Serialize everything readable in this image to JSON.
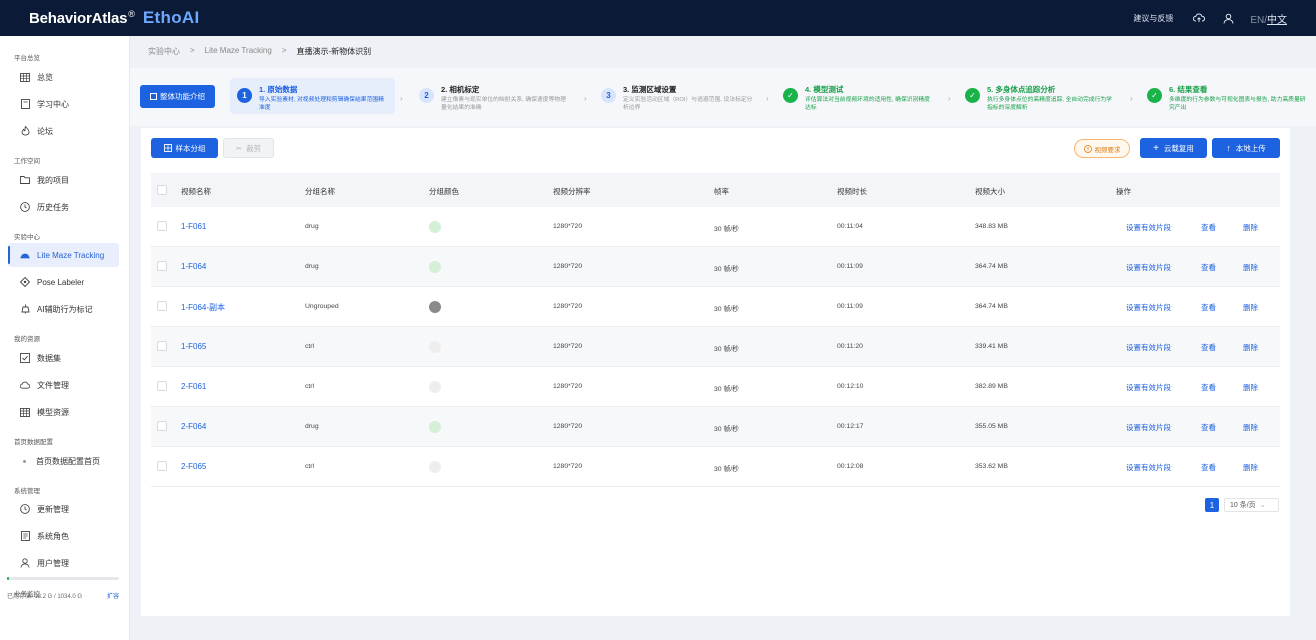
{
  "topbar": {
    "brand": "BehaviorAtlas",
    "brand_reg": "®",
    "brand_sub": "EthoAI",
    "feedback": "建议与反馈",
    "lang_en": "EN/",
    "lang_zh": "中文",
    "icons": [
      "cloud-upload-icon",
      "user-icon"
    ]
  },
  "sidebar": {
    "sections": [
      "平台总览",
      "工作空间",
      "实验中心",
      "我的资源",
      "首页数据配置",
      "系统管理",
      "业务监控"
    ],
    "items": [
      {
        "label": "总览",
        "icon": "grid-icon"
      },
      {
        "label": "学习中心",
        "icon": "book-icon"
      },
      {
        "label": "论坛",
        "icon": "fire-icon"
      },
      {
        "label": "我的项目",
        "icon": "folder-icon"
      },
      {
        "label": "历史任务",
        "icon": "clock-icon"
      },
      {
        "label": "Lite Maze Tracking",
        "icon": "maze-icon"
      },
      {
        "label": "Pose Labeler",
        "icon": "pose-icon"
      },
      {
        "label": "AI辅助行为标记",
        "icon": "ai-icon"
      },
      {
        "label": "数据集",
        "icon": "dataset-icon"
      },
      {
        "label": "文件管理",
        "icon": "cloud-icon"
      },
      {
        "label": "模型资源",
        "icon": "table-icon"
      },
      {
        "label": "首页数据配置首页",
        "icon": "dot-icon"
      },
      {
        "label": "更新管理",
        "icon": "refresh-icon"
      },
      {
        "label": "系统角色",
        "icon": "role-icon"
      },
      {
        "label": "用户管理",
        "icon": "user-icon"
      }
    ],
    "storage_text": "已用存储: 18.2 G / 1034.0 G",
    "storage_link": "扩容",
    "storage_fraction": 0.018
  },
  "breadcrumb": [
    "实验中心",
    ">",
    "Lite Maze Tracking",
    ">",
    "直播演示-新物体识别"
  ],
  "intro_button": "整体功能介绍",
  "steps": [
    {
      "num": "1",
      "title": "1. 原始数据",
      "desc": "导入实验素材, 对视频处理和剪辑确保结果范围精准度"
    },
    {
      "num": "2",
      "title": "2. 相机标定",
      "desc": "建立像素与现实单位的映射关系, 确保速度等物理量化结果的准确"
    },
    {
      "num": "3",
      "title": "3. 监测区域设置",
      "desc": "定义实验活动区域（ROI）与逃避范围, 设法标定分析边界"
    },
    {
      "num": "✓",
      "title": "4. 模型测试",
      "desc": "评估算法对当前视频环境的适用性, 确保识别精度达标"
    },
    {
      "num": "✓",
      "title": "5. 多身体点追踪分析",
      "desc": "执行多身体点位的高精度追踪, 全自动完成行为学指标的深度解析"
    },
    {
      "num": "✓",
      "title": "6. 结果查看",
      "desc": "多维度的行为参数与可视化图表与报告, 助力高质量研究产出"
    }
  ],
  "toolbar": {
    "group_btn": "样本分组",
    "cut_btn": "裁剪",
    "video_req": "视频要求",
    "cloud_btn": "云载复用",
    "upload_btn": "本地上传"
  },
  "table": {
    "headers": [
      "视频名称",
      "分组名称",
      "分组颜色",
      "视频分辨率",
      "帧率",
      "视频时长",
      "视频大小",
      "操作"
    ],
    "ops": [
      "设置有效片段",
      "查看",
      "删除"
    ],
    "rows": [
      {
        "name": "1-F061",
        "group": "drug",
        "color": "#d4f0d6",
        "res": "1280*720",
        "fps": "30 帧/秒",
        "dur": "00:11:04",
        "size": "348.83 MB"
      },
      {
        "name": "1-F064",
        "group": "drug",
        "color": "#d4f0d6",
        "res": "1280*720",
        "fps": "30 帧/秒",
        "dur": "00:11:09",
        "size": "364.74 MB"
      },
      {
        "name": "1-F064-副本",
        "group": "Ungrouped",
        "color": "#8a8a8a",
        "res": "1280*720",
        "fps": "30 帧/秒",
        "dur": "00:11:09",
        "size": "364.74 MB"
      },
      {
        "name": "1-F065",
        "group": "ctrl",
        "color": "#eeeeee",
        "res": "1280*720",
        "fps": "30 帧/秒",
        "dur": "00:11:20",
        "size": "339.41 MB"
      },
      {
        "name": "2-F061",
        "group": "ctrl",
        "color": "#eeeeee",
        "res": "1280*720",
        "fps": "30 帧/秒",
        "dur": "00:12:10",
        "size": "382.89 MB"
      },
      {
        "name": "2-F064",
        "group": "drug",
        "color": "#d4f0d6",
        "res": "1280*720",
        "fps": "30 帧/秒",
        "dur": "00:12:17",
        "size": "355.05 MB"
      },
      {
        "name": "2-F065",
        "group": "ctrl",
        "color": "#eeeeee",
        "res": "1280*720",
        "fps": "30 帧/秒",
        "dur": "00:12:08",
        "size": "353.62 MB"
      }
    ]
  },
  "pagination": {
    "page": "1",
    "page_size": "10 条/页"
  }
}
